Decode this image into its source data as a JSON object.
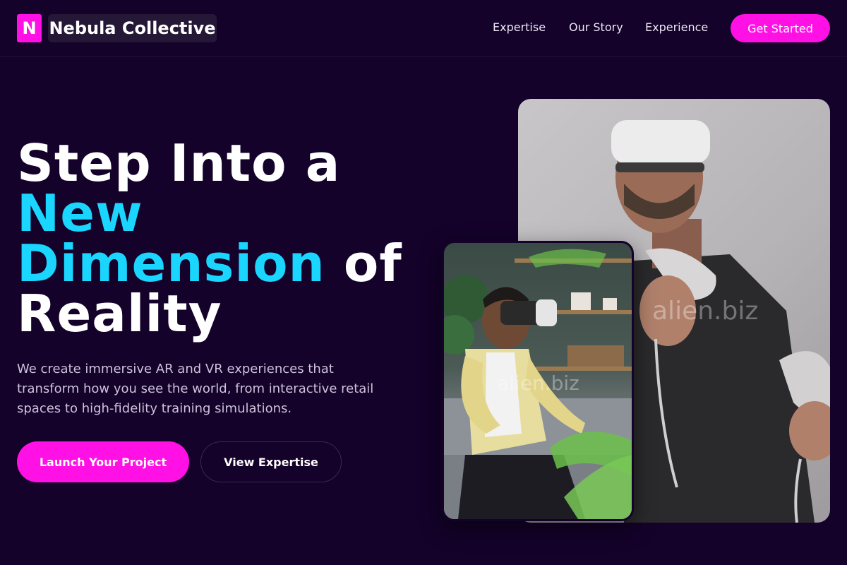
{
  "header": {
    "logo_letter": "N",
    "brand_name": "Nebula Collective",
    "nav": [
      "Expertise",
      "Our Story",
      "Experience"
    ],
    "cta_label": "Get Started"
  },
  "hero": {
    "title_line1": "Step Into a",
    "title_accent": "New Dimension",
    "title_after_accent": "of",
    "title_line_last": "Reality",
    "description": "We create immersive AR and VR experiences that transform how you see the world, from interactive retail spaces to high-fidelity training simulations.",
    "primary_button": "Launch Your Project",
    "secondary_button": "View Expertise"
  },
  "images": {
    "large_watermark": "alien.biz",
    "small_watermark": "alien.biz"
  },
  "colors": {
    "background": "#14022a",
    "accent_magenta": "#ff10e4",
    "accent_cyan": "#1ad6ff"
  }
}
